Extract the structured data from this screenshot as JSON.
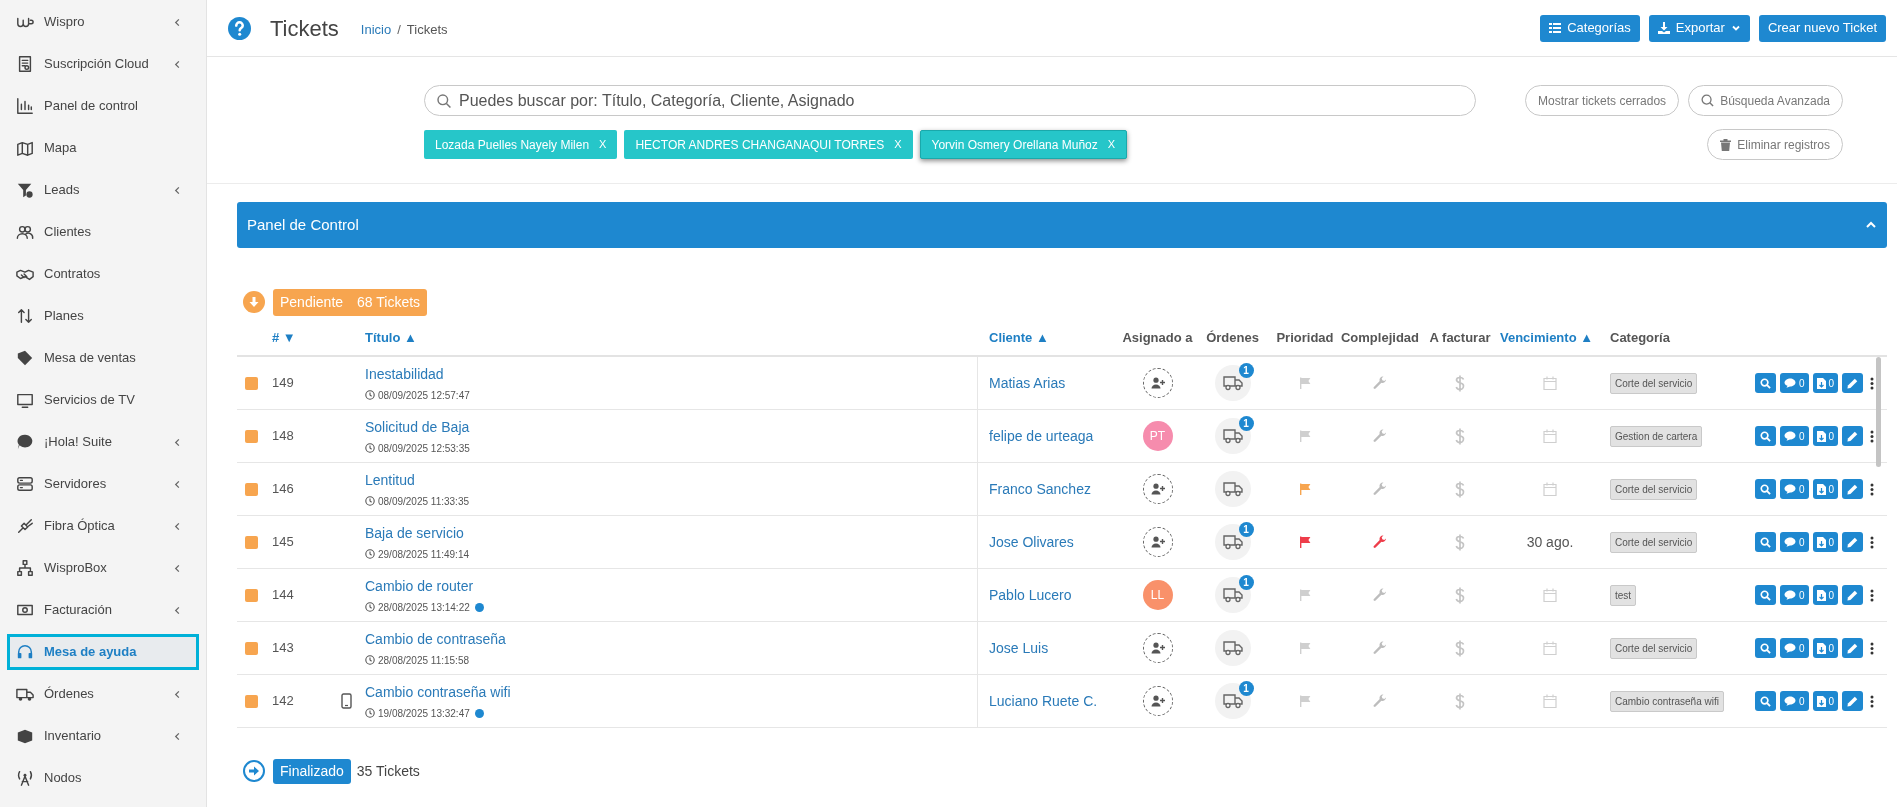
{
  "sidebar": {
    "items": [
      {
        "label": "Wispro",
        "has_submenu": true,
        "selected": false
      },
      {
        "label": "Suscripción Cloud",
        "has_submenu": true,
        "selected": false
      },
      {
        "label": "Panel de control",
        "has_submenu": false,
        "selected": false
      },
      {
        "label": "Mapa",
        "has_submenu": false,
        "selected": false
      },
      {
        "label": "Leads",
        "has_submenu": true,
        "selected": false
      },
      {
        "label": "Clientes",
        "has_submenu": false,
        "selected": false
      },
      {
        "label": "Contratos",
        "has_submenu": false,
        "selected": false
      },
      {
        "label": "Planes",
        "has_submenu": false,
        "selected": false
      },
      {
        "label": "Mesa de ventas",
        "has_submenu": false,
        "selected": false
      },
      {
        "label": "Servicios de TV",
        "has_submenu": false,
        "selected": false
      },
      {
        "label": "¡Hola! Suite",
        "has_submenu": true,
        "selected": false
      },
      {
        "label": "Servidores",
        "has_submenu": true,
        "selected": false
      },
      {
        "label": "Fibra Óptica",
        "has_submenu": true,
        "selected": false
      },
      {
        "label": "WisproBox",
        "has_submenu": true,
        "selected": false
      },
      {
        "label": "Facturación",
        "has_submenu": true,
        "selected": false
      },
      {
        "label": "Mesa de ayuda",
        "has_submenu": false,
        "selected": true
      },
      {
        "label": "Órdenes",
        "has_submenu": true,
        "selected": false
      },
      {
        "label": "Inventario",
        "has_submenu": true,
        "selected": false
      },
      {
        "label": "Nodos",
        "has_submenu": false,
        "selected": false
      }
    ]
  },
  "header": {
    "title": "Tickets",
    "breadcrumb": [
      {
        "label": "Inicio",
        "link": true
      },
      {
        "label": "Tickets",
        "link": false
      }
    ],
    "separator": "/",
    "buttons": [
      {
        "label": "Categorías",
        "kind": "list"
      },
      {
        "label": "Exportar",
        "kind": "export"
      },
      {
        "label": "Crear nuevo Ticket",
        "kind": "plain"
      }
    ]
  },
  "search": {
    "placeholder": "Puedes buscar por: Título, Categoría, Cliente, Asignado",
    "chips": [
      {
        "label": "Lozada Puelles Nayely Milen",
        "close": "X",
        "selected": false
      },
      {
        "label": "HECTOR ANDRES CHANGANAQUI TORRES",
        "close": "X",
        "selected": false
      },
      {
        "label": "Yorvin Osmery Orellana Muñoz",
        "close": "X",
        "selected": true
      }
    ],
    "buttons": [
      {
        "label": "Mostrar tickets cerrados",
        "kind": "plain"
      },
      {
        "label": "Búsqueda Avanzada",
        "kind": "search"
      },
      {
        "label": "Eliminar registros",
        "kind": "delete"
      }
    ]
  },
  "panel": {
    "title": "Panel de Control"
  },
  "groups": [
    {
      "label": "Pendiente",
      "count": "68 Tickets",
      "color": "#f7a54f",
      "expanded": true
    },
    {
      "label": "Finalizado",
      "count": "35 Tickets",
      "color": "#1e88d0",
      "expanded": false
    }
  ],
  "table": {
    "columns": [
      {
        "label": "# ▼",
        "sortable": true
      },
      {
        "label": "Título ▲",
        "sortable": true
      },
      {
        "label": "Cliente ▲",
        "sortable": true
      },
      {
        "label": "Asignado a",
        "sortable": false
      },
      {
        "label": "Órdenes",
        "sortable": false
      },
      {
        "label": "Prioridad",
        "sortable": false
      },
      {
        "label": "Complejidad",
        "sortable": false
      },
      {
        "label": "A facturar",
        "sortable": false
      },
      {
        "label": "Vencimiento ▲",
        "sortable": true
      },
      {
        "label": "Categoría",
        "sortable": false
      }
    ],
    "rows": [
      {
        "number": "149",
        "mobile": false,
        "title": "Inestabilidad",
        "date": "08/09/2025 12:57:47",
        "unread": false,
        "client": "Matias Arias",
        "orders": "1",
        "priority": {
          "color": "#cfcfcf"
        },
        "complexity": {
          "color": "#bdbdbd"
        },
        "category": "Corte del servicio",
        "comments": "0",
        "files": "0"
      },
      {
        "number": "148",
        "mobile": false,
        "title": "Solicitud de Baja",
        "date": "08/09/2025 12:53:35",
        "unread": false,
        "client": "felipe de urteaga",
        "assignee": {
          "initials": "PT",
          "color": "#f68cad"
        },
        "orders": "1",
        "priority": {
          "color": "#cfcfcf"
        },
        "complexity": {
          "color": "#bdbdbd"
        },
        "category": "Gestion de cartera",
        "comments": "0",
        "files": "0"
      },
      {
        "number": "146",
        "mobile": false,
        "title": "Lentitud",
        "date": "08/09/2025 11:33:35",
        "unread": false,
        "client": "Franco Sanchez",
        "priority": {
          "color": "#f7a54f"
        },
        "complexity": {
          "color": "#bdbdbd"
        },
        "category": "Corte del servicio",
        "comments": "0",
        "files": "0"
      },
      {
        "number": "145",
        "mobile": false,
        "title": "Baja de servicio",
        "date": "29/08/2025 11:49:14",
        "unread": false,
        "client": "Jose Olivares",
        "orders": "1",
        "priority": {
          "color": "#ee3d4a"
        },
        "complexity": {
          "color": "#ee3d4a"
        },
        "due": "30 ago.",
        "category": "Corte del servicio",
        "comments": "0",
        "files": "0"
      },
      {
        "number": "144",
        "mobile": false,
        "title": "Cambio de router",
        "date": "28/08/2025 13:14:22",
        "unread": true,
        "client": "Pablo Lucero",
        "assignee": {
          "initials": "LL",
          "color": "#f9916a"
        },
        "orders": "1",
        "priority": {
          "color": "#cfcfcf"
        },
        "complexity": {
          "color": "#bdbdbd"
        },
        "category": "test",
        "comments": "0",
        "files": "0"
      },
      {
        "number": "143",
        "mobile": false,
        "title": "Cambio de contraseña",
        "date": "28/08/2025 11:15:58",
        "unread": false,
        "client": "Jose Luis",
        "priority": {
          "color": "#cfcfcf"
        },
        "complexity": {
          "color": "#bdbdbd"
        },
        "category": "Corte del servicio",
        "comments": "0",
        "files": "0"
      },
      {
        "number": "142",
        "mobile": true,
        "title": "Cambio contraseña wifi",
        "date": "19/08/2025 13:32:47",
        "unread": true,
        "client": "Luciano Ruete C.",
        "orders": "1",
        "priority": {
          "color": "#cfcfcf"
        },
        "complexity": {
          "color": "#bdbdbd"
        },
        "category": "Cambio contraseña wifi",
        "comments": "0",
        "files": "0"
      }
    ]
  }
}
